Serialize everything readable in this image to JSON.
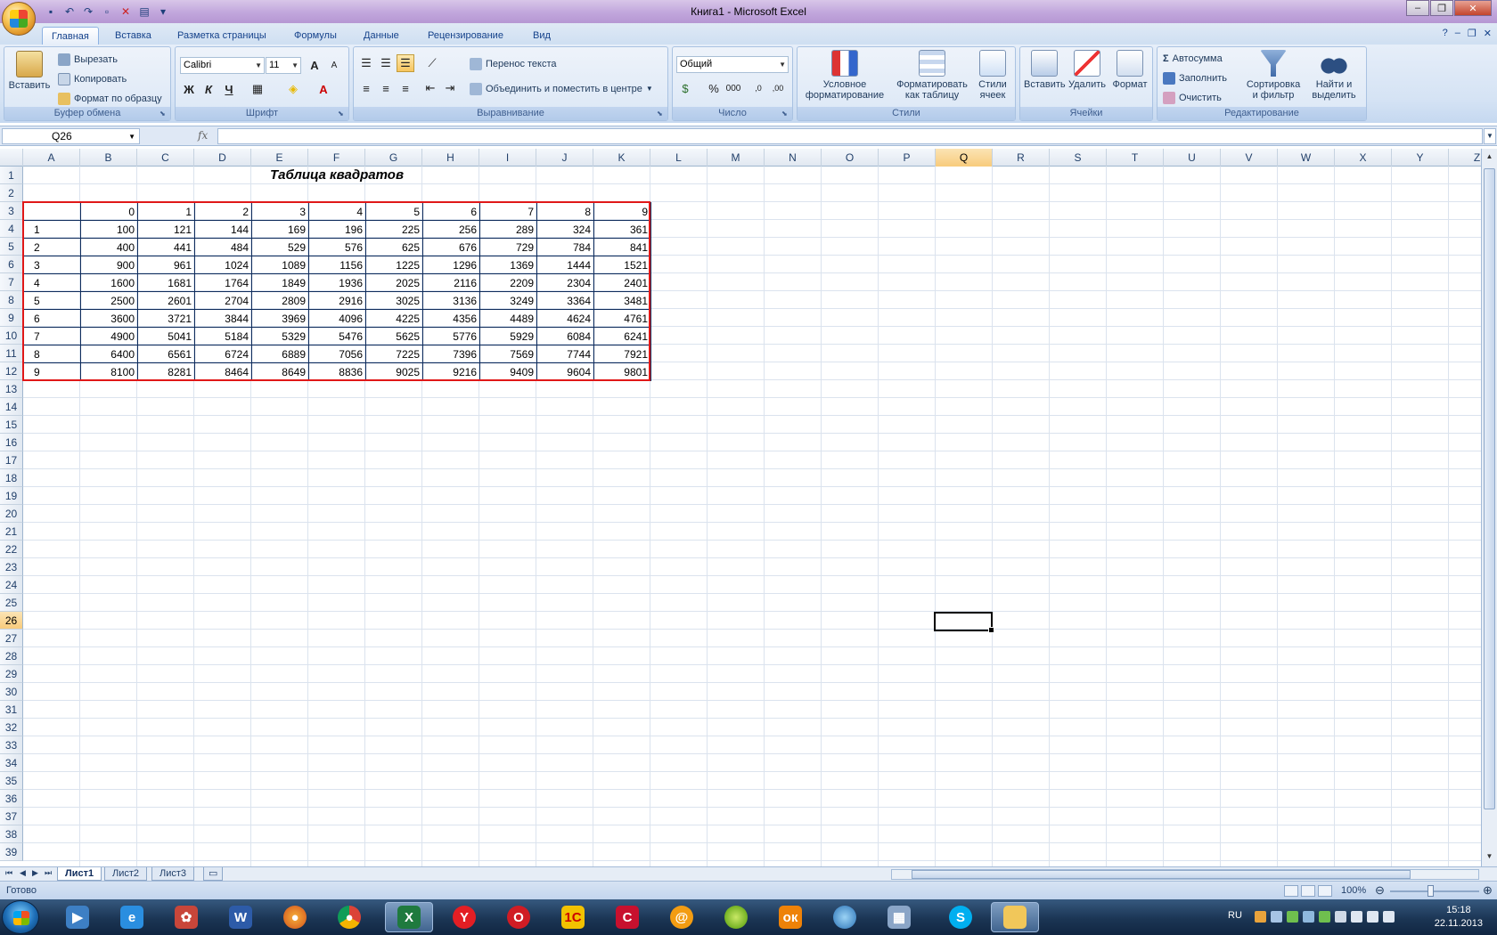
{
  "window": {
    "title": "Книга1 - Microsoft Excel"
  },
  "tabs": [
    "Главная",
    "Вставка",
    "Разметка страницы",
    "Формулы",
    "Данные",
    "Рецензирование",
    "Вид"
  ],
  "ribbon": {
    "clipboard": {
      "label": "Буфер обмена",
      "paste": "Вставить",
      "cut": "Вырезать",
      "copy": "Копировать",
      "format_painter": "Формат по образцу"
    },
    "font": {
      "label": "Шрифт",
      "name": "Calibri",
      "size": "11",
      "bold": "Ж",
      "italic": "К",
      "underline": "Ч",
      "grow": "A",
      "shrink": "A",
      "color_letter": "A"
    },
    "alignment": {
      "label": "Выравнивание",
      "wrap": "Перенос текста",
      "merge": "Объединить и поместить в центре"
    },
    "number": {
      "label": "Число",
      "format": "Общий",
      "percent": "%",
      "thousands": "000",
      "inc_decimal": ",0",
      "dec_decimal": ",00"
    },
    "styles": {
      "label": "Стили",
      "conditional_1": "Условное",
      "conditional_2": "форматирование",
      "format_table_1": "Форматировать",
      "format_table_2": "как таблицу",
      "cell_styles_1": "Стили",
      "cell_styles_2": "ячеек"
    },
    "cells": {
      "label": "Ячейки",
      "insert": "Вставить",
      "delete": "Удалить",
      "format": "Формат"
    },
    "editing": {
      "label": "Редактирование",
      "autosum": "Автосумма",
      "fill": "Заполнить",
      "clear": "Очистить",
      "sort_1": "Сортировка",
      "sort_2": "и фильтр",
      "find_1": "Найти и",
      "find_2": "выделить"
    }
  },
  "formula_bar": {
    "name_box": "Q26",
    "fx": "fx",
    "value": ""
  },
  "columns": [
    "A",
    "B",
    "C",
    "D",
    "E",
    "F",
    "G",
    "H",
    "I",
    "J",
    "K",
    "L",
    "M",
    "N",
    "O",
    "P",
    "Q",
    "R",
    "S",
    "T",
    "U",
    "V",
    "W",
    "X",
    "Y",
    "Z"
  ],
  "selected_column": "Q",
  "row_count": 39,
  "selected_row": 26,
  "sheet": {
    "title": "Таблица квадратов",
    "header_row": [
      "",
      "0",
      "1",
      "2",
      "3",
      "4",
      "5",
      "6",
      "7",
      "8",
      "9"
    ],
    "rows": [
      [
        "1",
        "100",
        "121",
        "144",
        "169",
        "196",
        "225",
        "256",
        "289",
        "324",
        "361"
      ],
      [
        "2",
        "400",
        "441",
        "484",
        "529",
        "576",
        "625",
        "676",
        "729",
        "784",
        "841"
      ],
      [
        "3",
        "900",
        "961",
        "1024",
        "1089",
        "1156",
        "1225",
        "1296",
        "1369",
        "1444",
        "1521"
      ],
      [
        "4",
        "1600",
        "1681",
        "1764",
        "1849",
        "1936",
        "2025",
        "2116",
        "2209",
        "2304",
        "2401"
      ],
      [
        "5",
        "2500",
        "2601",
        "2704",
        "2809",
        "2916",
        "3025",
        "3136",
        "3249",
        "3364",
        "3481"
      ],
      [
        "6",
        "3600",
        "3721",
        "3844",
        "3969",
        "4096",
        "4225",
        "4356",
        "4489",
        "4624",
        "4761"
      ],
      [
        "7",
        "4900",
        "5041",
        "5184",
        "5329",
        "5476",
        "5625",
        "5776",
        "5929",
        "6084",
        "6241"
      ],
      [
        "8",
        "6400",
        "6561",
        "6724",
        "6889",
        "7056",
        "7225",
        "7396",
        "7569",
        "7744",
        "7921"
      ],
      [
        "9",
        "8100",
        "8281",
        "8464",
        "8649",
        "8836",
        "9025",
        "9216",
        "9409",
        "9604",
        "9801"
      ]
    ]
  },
  "sheet_tabs": [
    "Лист1",
    "Лист2",
    "Лист3"
  ],
  "active_sheet": "Лист1",
  "status": {
    "text": "Готово",
    "zoom": "100%"
  },
  "taskbar": {
    "lang": "RU",
    "time": "15:18",
    "date": "22.11.2013"
  },
  "colors": {
    "accent": "#15428b",
    "table_frame": "#e01818",
    "title_bar": "#c1a6dc"
  }
}
